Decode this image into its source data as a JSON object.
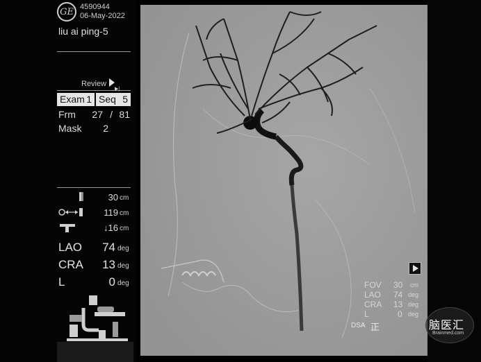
{
  "patient": {
    "id": "4590944",
    "date": "06-May-2022",
    "name": "liu ai ping-5"
  },
  "logo": {
    "text": "GE"
  },
  "review": {
    "label": "Review"
  },
  "exam": {
    "label": "Exam",
    "value": "1"
  },
  "seq": {
    "label": "Seq",
    "value": "5"
  },
  "frame": {
    "label": "Frm",
    "current": "27",
    "sep": "/",
    "total": "81"
  },
  "mask": {
    "label": "Mask",
    "value": "2"
  },
  "geometry": {
    "fov": {
      "value": "30",
      "unit": "cm"
    },
    "sid": {
      "value": "119",
      "unit": "cm"
    },
    "table": {
      "value": "↓16",
      "unit": "cm"
    }
  },
  "angles": {
    "lao": {
      "label": "LAO",
      "value": "74",
      "unit": "deg"
    },
    "cra": {
      "label": "CRA",
      "value": "13",
      "unit": "deg"
    },
    "l": {
      "label": "L",
      "value": "0",
      "unit": "deg"
    }
  },
  "overlay": {
    "fov": {
      "label": "FOV",
      "value": "30",
      "unit": "cm"
    },
    "lao": {
      "label": "LAO",
      "value": "74",
      "unit": "deg"
    },
    "cra": {
      "label": "CRA",
      "value": "13",
      "unit": "deg"
    },
    "l": {
      "label": "L",
      "value": "0",
      "unit": "deg"
    },
    "dsa": "DSA",
    "orientation": "正"
  },
  "watermark": {
    "main": "脑医汇",
    "sub": "Brainmed.com"
  },
  "colors": {
    "background": "#000000",
    "image_gray": "#9d9d9d",
    "text": "#d8d8d8",
    "highlight_box": "#e6e6e6"
  }
}
